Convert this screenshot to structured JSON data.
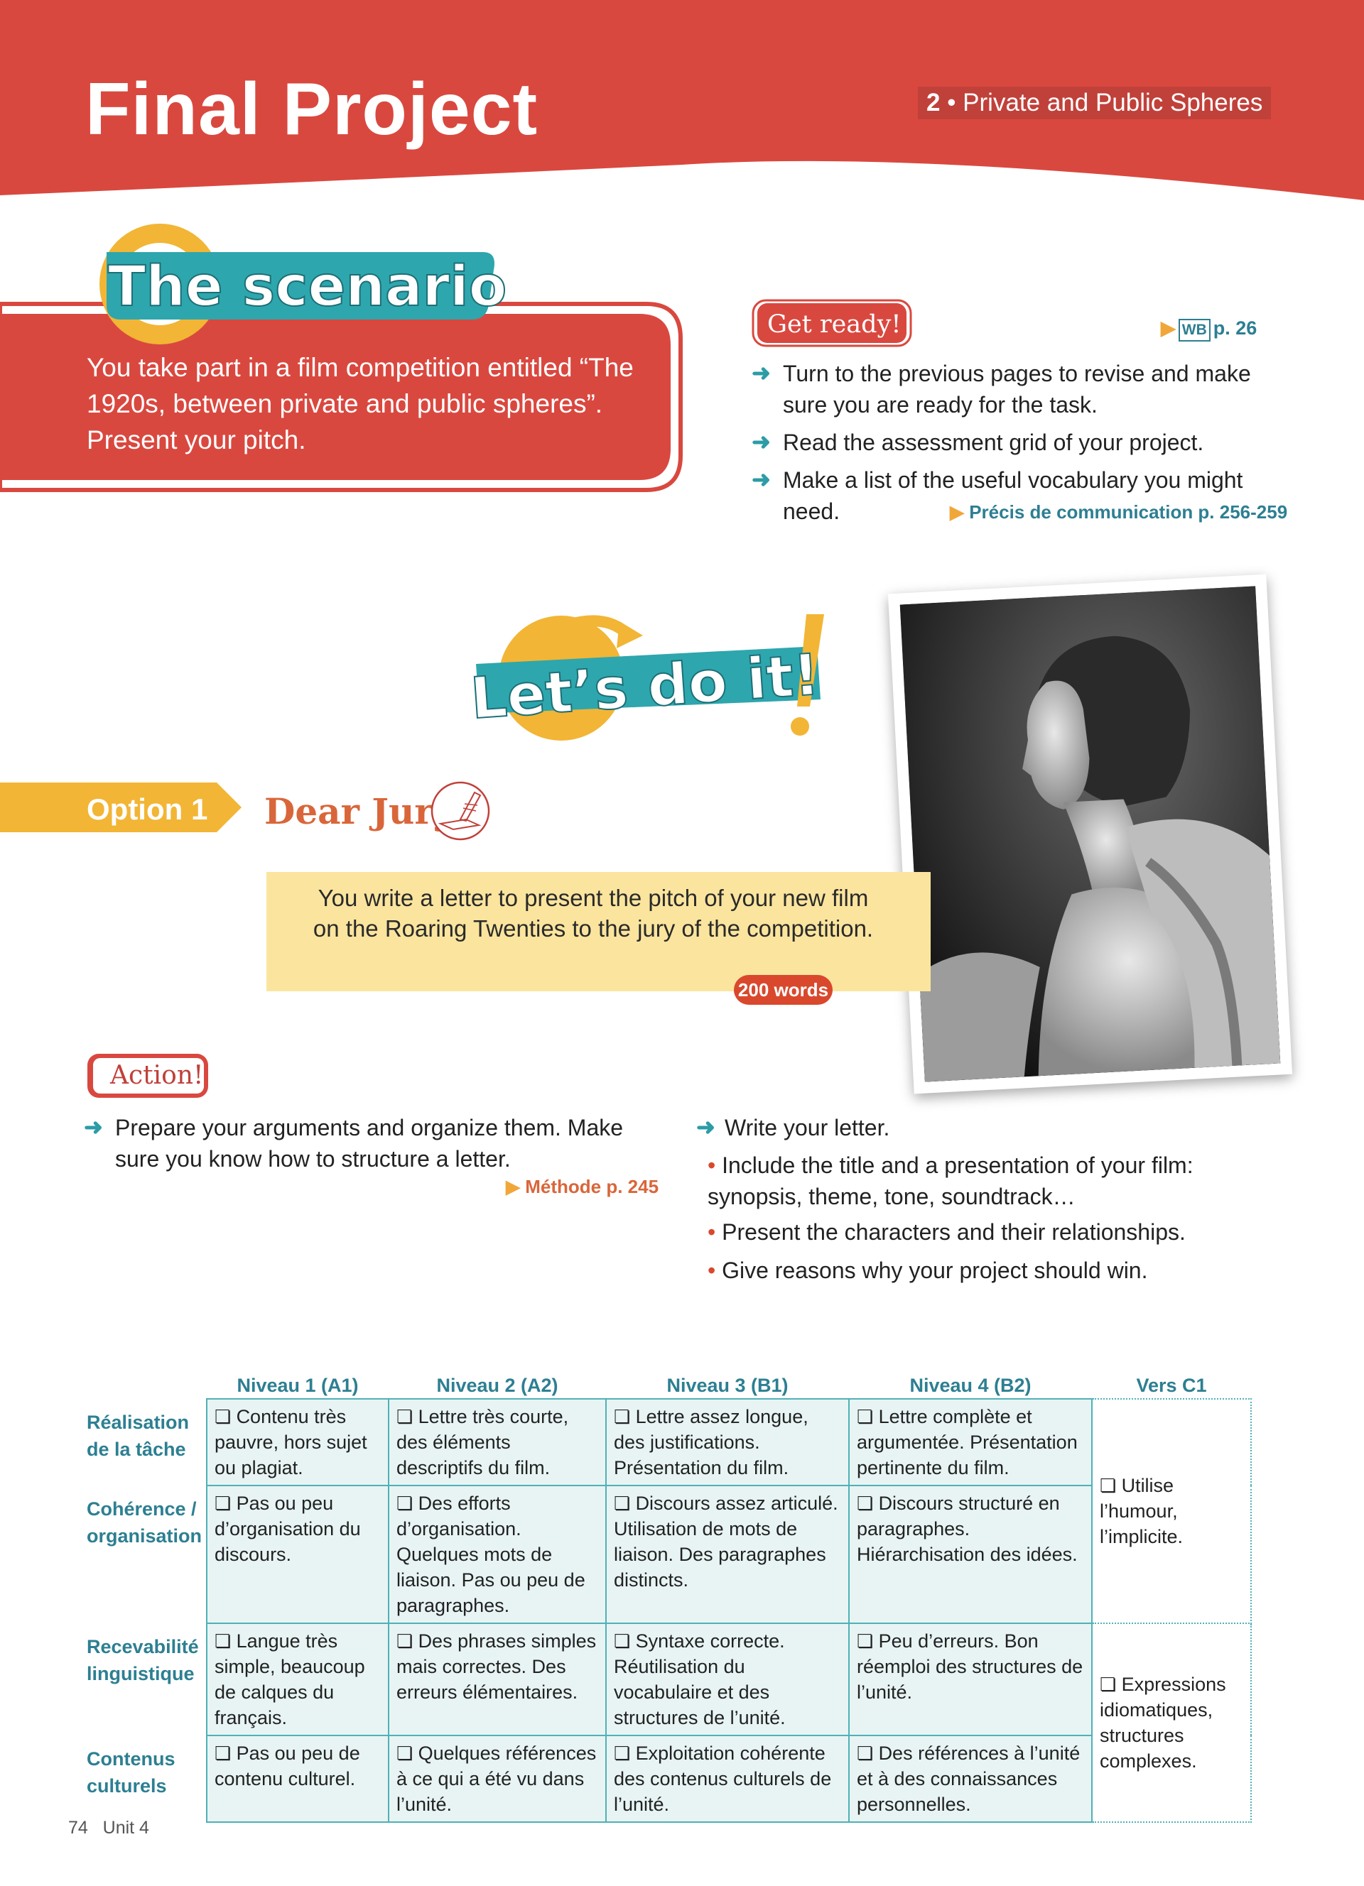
{
  "header": {
    "title": "Final Project",
    "unit_number": "2",
    "unit_separator": " • ",
    "unit_name": "Private and Public Spheres"
  },
  "scenario": {
    "heading": "The scenario",
    "text": "You take part in a film competition entitled “The 1920s, between private and public spheres”. Present your pitch."
  },
  "get_ready": {
    "label": "Get ready!",
    "workbook_icon": "WB",
    "workbook_page": "p. 26",
    "steps": [
      "Turn to the previous pages to revise and make sure you are ready for the task.",
      "Read the assessment grid of your project.",
      "Make a list of the useful vocabulary you might need."
    ],
    "reference": "Précis de communication p. 256-259"
  },
  "lets_do_it": {
    "label": "Let’s do it!"
  },
  "option": {
    "label": "Option 1",
    "title": "Dear Jury",
    "icon": "pen-writing-icon",
    "task": "You write a letter to present the pitch of your new film on the Roaring Twenties to the jury of the competition.",
    "word_count": "200 words"
  },
  "action": {
    "label": "Action!",
    "left_steps": [
      "Prepare your arguments and organize them. Make sure you know how to structure a letter."
    ],
    "methode_ref": "Méthode p. 245",
    "right_step": "Write your letter.",
    "bullets": [
      "Include the title and a presentation of your film: synopsis, theme, tone, soundtrack…",
      "Present the characters and their relationships.",
      "Give reasons why your project should win."
    ]
  },
  "grid": {
    "columns": [
      "Niveau 1 (A1)",
      "Niveau 2 (A2)",
      "Niveau 3 (B1)",
      "Niveau 4 (B2)",
      "Vers C1"
    ],
    "rows": [
      {
        "label": "Réalisation de la tâche",
        "cells": [
          "Contenu très pauvre, hors sujet ou plagiat.",
          "Lettre très courte, des éléments descriptifs du film.",
          "Lettre assez longue, des justifications. Présentation du film.",
          "Lettre complète et argumentée. Présentation pertinente du film."
        ]
      },
      {
        "label": "Cohérence / organisation",
        "cells": [
          "Pas ou peu d’organisation du discours.",
          "Des efforts d’organisation. Quelques mots de liaison. Pas ou peu de paragraphes.",
          "Discours assez articulé. Utilisation de mots de liaison. Des paragraphes distincts.",
          "Discours structuré en paragraphes. Hiérarchisation des idées."
        ]
      },
      {
        "label": "Recevabilité linguistique",
        "cells": [
          "Langue très simple, beaucoup de calques du français.",
          "Des phrases simples mais correctes. Des erreurs élémentaires.",
          "Syntaxe correcte. Réutilisation du vocabulaire et des structures de l’unité.",
          "Peu d’erreurs. Bon réemploi des structures de l’unité."
        ]
      },
      {
        "label": "Contenus culturels",
        "cells": [
          "Pas ou peu de contenu culturel.",
          "Quelques références à ce qui a été vu dans l’unité.",
          "Exploitation cohérente des contenus culturels de l’unité.",
          "Des références à l’unité et à des connaissances personnelles."
        ]
      }
    ],
    "c1_top": "Utilise l’humour, l’implicite.",
    "c1_bottom": "Expressions idiomatiques, structures complexes."
  },
  "footer": {
    "page_number": "74",
    "unit": "Unit 4"
  }
}
